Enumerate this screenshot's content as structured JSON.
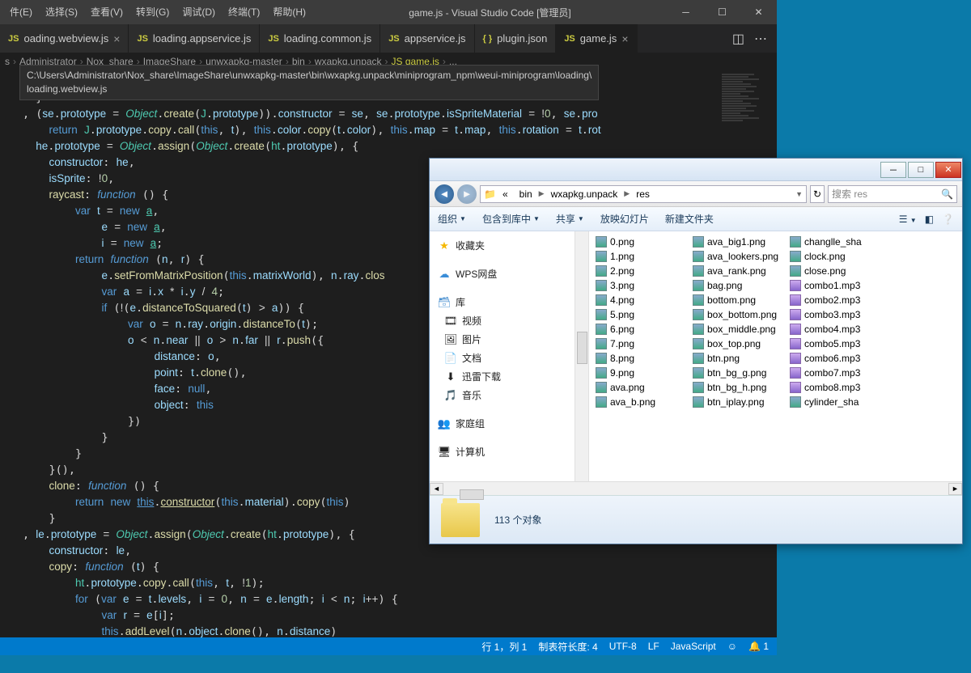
{
  "menubar": [
    "件(E)",
    "选择(S)",
    "查看(V)",
    "转到(G)",
    "调试(D)",
    "终端(T)",
    "帮助(H)"
  ],
  "title": "game.js - Visual Studio Code [管理员]",
  "tabs": [
    {
      "icon": "JS",
      "label": "oading.webview.js",
      "close": "×"
    },
    {
      "icon": "JS",
      "label": "loading.appservice.js",
      "close": ""
    },
    {
      "icon": "JS",
      "label": "loading.common.js",
      "close": ""
    },
    {
      "icon": "JS",
      "label": "appservice.js",
      "close": ""
    },
    {
      "icon": "{ }",
      "label": "plugin.json",
      "close": ""
    },
    {
      "icon": "JS",
      "label": "game.js",
      "close": "×",
      "active": true
    }
  ],
  "breadcrumb": [
    "s",
    "Administrator",
    "Nox_share",
    "ImageShare",
    "unwxapkg-master",
    "bin",
    "wxapkg.unpack",
    "JS  game.js",
    "..."
  ],
  "tooltip": {
    "path": "C:\\Users\\Administrator\\Nox_share\\ImageShare\\unwxapkg-master\\bin\\wxapkg.unpack\\miniprogram_npm\\weui-miniprogram\\loading\\",
    "file": "loading.webview.js"
  },
  "status": {
    "pos": "行 1，列 1",
    "tab": "制表符长度: 4",
    "enc": "UTF-8",
    "eol": "LF",
    "lang": "JavaScript",
    "bell": "1"
  },
  "explorer": {
    "nav": {
      "segs": [
        "«",
        "bin",
        "wxapkg.unpack",
        "res"
      ],
      "search_ph": "搜索 res"
    },
    "toolbar": [
      "组织",
      "包含到库中",
      "共享",
      "放映幻灯片",
      "新建文件夹"
    ],
    "sidebar": {
      "fav": "收藏夹",
      "wps": "WPS网盘",
      "lib": "库",
      "video": "视频",
      "pic": "图片",
      "doc": "文档",
      "xl": "迅雷下载",
      "music": "音乐",
      "home": "家庭组",
      "comp": "计算机"
    },
    "cols": [
      [
        "0.png",
        "1.png",
        "2.png",
        "3.png",
        "4.png",
        "5.png",
        "6.png",
        "7.png",
        "8.png",
        "9.png",
        "ava.png",
        "ava_b.png"
      ],
      [
        "ava_big1.png",
        "ava_lookers.png",
        "ava_rank.png",
        "bag.png",
        "bottom.png",
        "box_bottom.png",
        "box_middle.png",
        "box_top.png",
        "btn.png",
        "btn_bg_g.png",
        "btn_bg_h.png",
        "btn_iplay.png"
      ],
      [
        "changlle_sha",
        "clock.png",
        "close.png",
        "combo1.mp3",
        "combo2.mp3",
        "combo3.mp3",
        "combo4.mp3",
        "combo5.mp3",
        "combo6.mp3",
        "combo7.mp3",
        "combo8.mp3",
        "cylinder_sha"
      ]
    ],
    "status_text": "113 个对象"
  }
}
